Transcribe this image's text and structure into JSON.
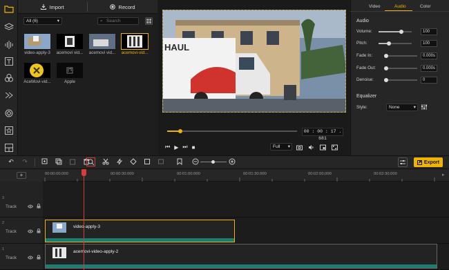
{
  "media": {
    "import_label": "Import",
    "record_label": "Record",
    "filter": "All (6)",
    "search_placeholder": "Search",
    "items": [
      {
        "label": "video-apply-3"
      },
      {
        "label": "acemovi vid..."
      },
      {
        "label": "acemovi vid..."
      },
      {
        "label": "acemovi-vid..."
      },
      {
        "label": "AceMovi-vid..."
      },
      {
        "label": "Apple"
      }
    ]
  },
  "preview": {
    "truck_text": "HAUL",
    "timecode": "00 : 00 : 17 . 681",
    "zoom": "Full",
    "progress": 0.1
  },
  "props": {
    "tabs": [
      "Video",
      "Audio",
      "Color"
    ],
    "active_tab": "Audio",
    "audio_title": "Audio",
    "rows": [
      {
        "label": "Volume:",
        "value": "100",
        "level": 0.7
      },
      {
        "label": "Pitch:",
        "value": "100",
        "level": 0.7
      },
      {
        "label": "Fade In:",
        "value": "0.000s",
        "level": 0
      },
      {
        "label": "Fade Out:",
        "value": "0.000s",
        "level": 0
      },
      {
        "label": "Denoise:",
        "value": "0",
        "level": 0
      }
    ],
    "eq_title": "Equalizer",
    "style_label": "Style:",
    "style_value": "None"
  },
  "toolbar": {
    "export_label": "Export"
  },
  "timeline": {
    "ruler": [
      "00:00:00.000",
      "00:00:30.000",
      "00:01:00.000",
      "00:01:30.000",
      "00:02:00.000",
      "00:02:30.000"
    ],
    "tracks": [
      {
        "num": "3",
        "name": "Track"
      },
      {
        "num": "2",
        "name": "Track"
      },
      {
        "num": "1",
        "name": "Track"
      }
    ],
    "clips": [
      {
        "name": "video-apply-3"
      },
      {
        "name": "acemovi-video-apply-2"
      }
    ]
  },
  "colors": {
    "accent": "#f0b400",
    "playhead": "#d93a3a",
    "wave": "#1d7d70"
  }
}
